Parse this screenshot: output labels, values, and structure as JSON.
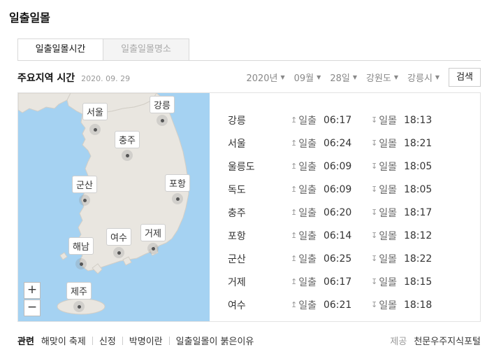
{
  "title": "일출일몰",
  "tabs": [
    {
      "label": "일출일몰시간",
      "active": true
    },
    {
      "label": "일출일몰명소",
      "active": false
    }
  ],
  "section": {
    "title": "주요지역 시간",
    "date": "2020. 09. 29"
  },
  "filters": {
    "year": "2020년",
    "month": "09월",
    "day": "28일",
    "province": "강원도",
    "city": "강릉시",
    "search_label": "검색"
  },
  "map": {
    "pins": [
      "서울",
      "강릉",
      "충주",
      "군산",
      "포항",
      "여수",
      "거제",
      "해남",
      "제주"
    ],
    "zoom_in": "+",
    "zoom_out": "−",
    "colors": {
      "sea": "#a5d2f2",
      "land": "#e9e6e0"
    }
  },
  "table": {
    "sunrise_label": "일출",
    "sunset_label": "일몰",
    "rows": [
      {
        "city": "강릉",
        "sunrise": "06:17",
        "sunset": "18:13"
      },
      {
        "city": "서울",
        "sunrise": "06:24",
        "sunset": "18:21"
      },
      {
        "city": "울릉도",
        "sunrise": "06:09",
        "sunset": "18:05"
      },
      {
        "city": "독도",
        "sunrise": "06:09",
        "sunset": "18:05"
      },
      {
        "city": "충주",
        "sunrise": "06:20",
        "sunset": "18:17"
      },
      {
        "city": "포항",
        "sunrise": "06:14",
        "sunset": "18:12"
      },
      {
        "city": "군산",
        "sunrise": "06:25",
        "sunset": "18:22"
      },
      {
        "city": "거제",
        "sunrise": "06:17",
        "sunset": "18:15"
      },
      {
        "city": "여수",
        "sunrise": "06:21",
        "sunset": "18:18"
      }
    ]
  },
  "footer": {
    "related_label": "관련",
    "links": [
      "해맞이 축제",
      "신정",
      "박명이란",
      "일출일몰이 붉은이유"
    ],
    "provider_label": "제공",
    "provider_name": "천문우주지식포털"
  }
}
